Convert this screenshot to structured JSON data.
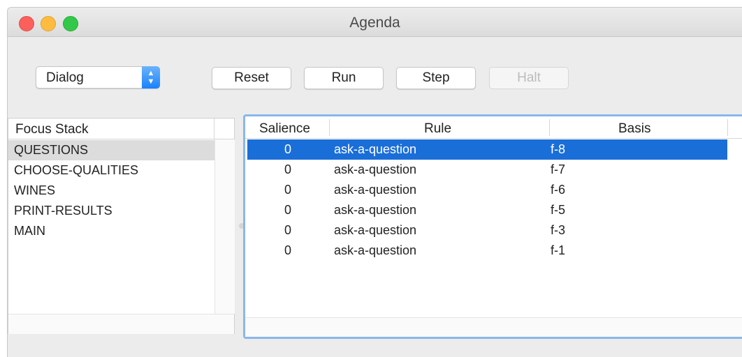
{
  "window": {
    "title": "Agenda"
  },
  "toolbar": {
    "module_select": "Dialog",
    "reset_label": "Reset",
    "run_label": "Run",
    "step_label": "Step",
    "halt_label": "Halt"
  },
  "focus_stack": {
    "header": "Focus Stack",
    "items": [
      "QUESTIONS",
      "CHOOSE-QUALITIES",
      "WINES",
      "PRINT-RESULTS",
      "MAIN"
    ],
    "selected_index": 0
  },
  "agenda": {
    "columns": [
      "Salience",
      "Rule",
      "Basis"
    ],
    "rows": [
      {
        "salience": "0",
        "rule": "ask-a-question",
        "basis": "f-8"
      },
      {
        "salience": "0",
        "rule": "ask-a-question",
        "basis": "f-7"
      },
      {
        "salience": "0",
        "rule": "ask-a-question",
        "basis": "f-6"
      },
      {
        "salience": "0",
        "rule": "ask-a-question",
        "basis": "f-5"
      },
      {
        "salience": "0",
        "rule": "ask-a-question",
        "basis": "f-3"
      },
      {
        "salience": "0",
        "rule": "ask-a-question",
        "basis": "f-1"
      }
    ],
    "selected_index": 0
  },
  "colors": {
    "selection_blue": "#1a6ed8",
    "focus_ring": "#89b7ea",
    "inactive_selection": "#dcdcdc",
    "close": "#fc605c",
    "minimize": "#fdbc40",
    "zoom": "#34c84a"
  }
}
